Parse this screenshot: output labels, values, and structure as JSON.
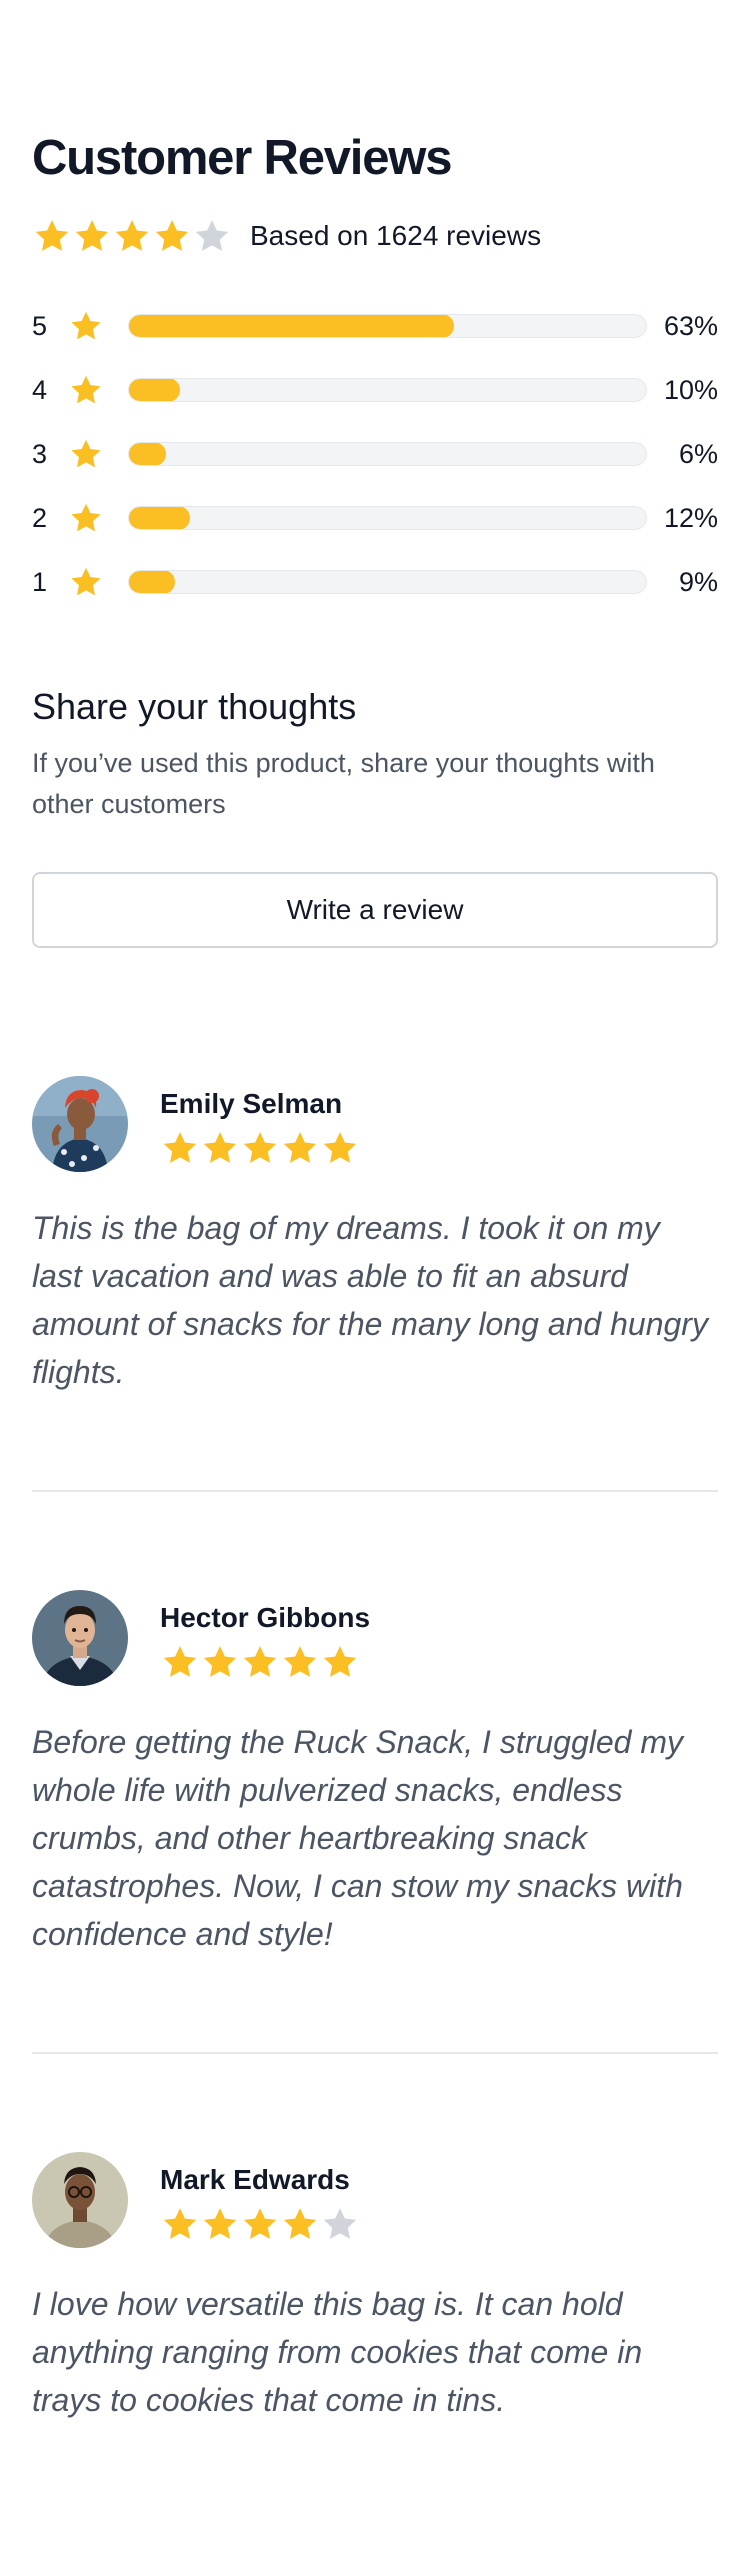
{
  "title": "Customer Reviews",
  "summary": {
    "average_rating": 4,
    "max_rating": 5,
    "based_on": "Based on 1624 reviews"
  },
  "distribution": [
    {
      "rating": "5",
      "percent_label": "63%",
      "fraction": 0.63
    },
    {
      "rating": "4",
      "percent_label": "10%",
      "fraction": 0.1
    },
    {
      "rating": "3",
      "percent_label": "6%",
      "fraction": 0.06
    },
    {
      "rating": "2",
      "percent_label": "12%",
      "fraction": 0.12
    },
    {
      "rating": "1",
      "percent_label": "9%",
      "fraction": 0.09
    }
  ],
  "share": {
    "heading": "Share your thoughts",
    "subtext": "If you’ve used this product, share your thoughts with other customers",
    "button_label": "Write a review"
  },
  "reviews": [
    {
      "name": "Emily Selman",
      "rating": 5,
      "body": "This is the bag of my dreams. I took it on my last vacation and was able to fit an absurd amount of snacks for the many long and hungry flights."
    },
    {
      "name": "Hector Gibbons",
      "rating": 5,
      "body": "Before getting the Ruck Snack, I struggled my whole life with pulverized snacks, endless crumbs, and other heartbreaking snack catastrophes. Now, I can stow my snacks with confidence and style!"
    },
    {
      "name": "Mark Edwards",
      "rating": 4,
      "body": "I love how versatile this bag is. It can hold anything ranging from cookies that come in trays to cookies that come in tins."
    }
  ],
  "colors": {
    "star_filled": "#fbbf24",
    "star_empty": "#d1d5db",
    "text_primary": "#111827",
    "text_secondary": "#4b5563"
  }
}
